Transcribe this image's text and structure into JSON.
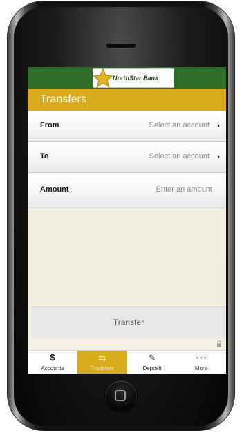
{
  "app": {
    "brand_name": "NorthStar Bank",
    "title": "Transfers"
  },
  "colors": {
    "header_green": "#2e6e2b",
    "accent_gold": "#d8aa1c",
    "background_cream": "#f2efdf"
  },
  "form": {
    "rows": [
      {
        "label": "From",
        "value": "Select an account",
        "has_chevron": true
      },
      {
        "label": "To",
        "value": "Select an account",
        "has_chevron": true
      },
      {
        "label": "Amount",
        "placeholder": "Enter an amount",
        "has_chevron": false
      }
    ],
    "chevron_glyph": "›"
  },
  "actions": {
    "transfer_label": "Transfer"
  },
  "icons": {
    "logo": "star-icon",
    "secure": "lock-icon"
  },
  "tabbar": {
    "tabs": [
      {
        "label": "Accounts",
        "icon": "dollar-icon",
        "glyph": "$",
        "active": false
      },
      {
        "label": "Transfers",
        "icon": "transfer-arrows-icon",
        "glyph": "⇆",
        "active": true
      },
      {
        "label": "Deposit",
        "icon": "check-deposit-icon",
        "glyph": "✎",
        "active": false
      },
      {
        "label": "More",
        "icon": "more-dots-icon",
        "glyph": "∘∘∘",
        "active": false
      }
    ]
  }
}
